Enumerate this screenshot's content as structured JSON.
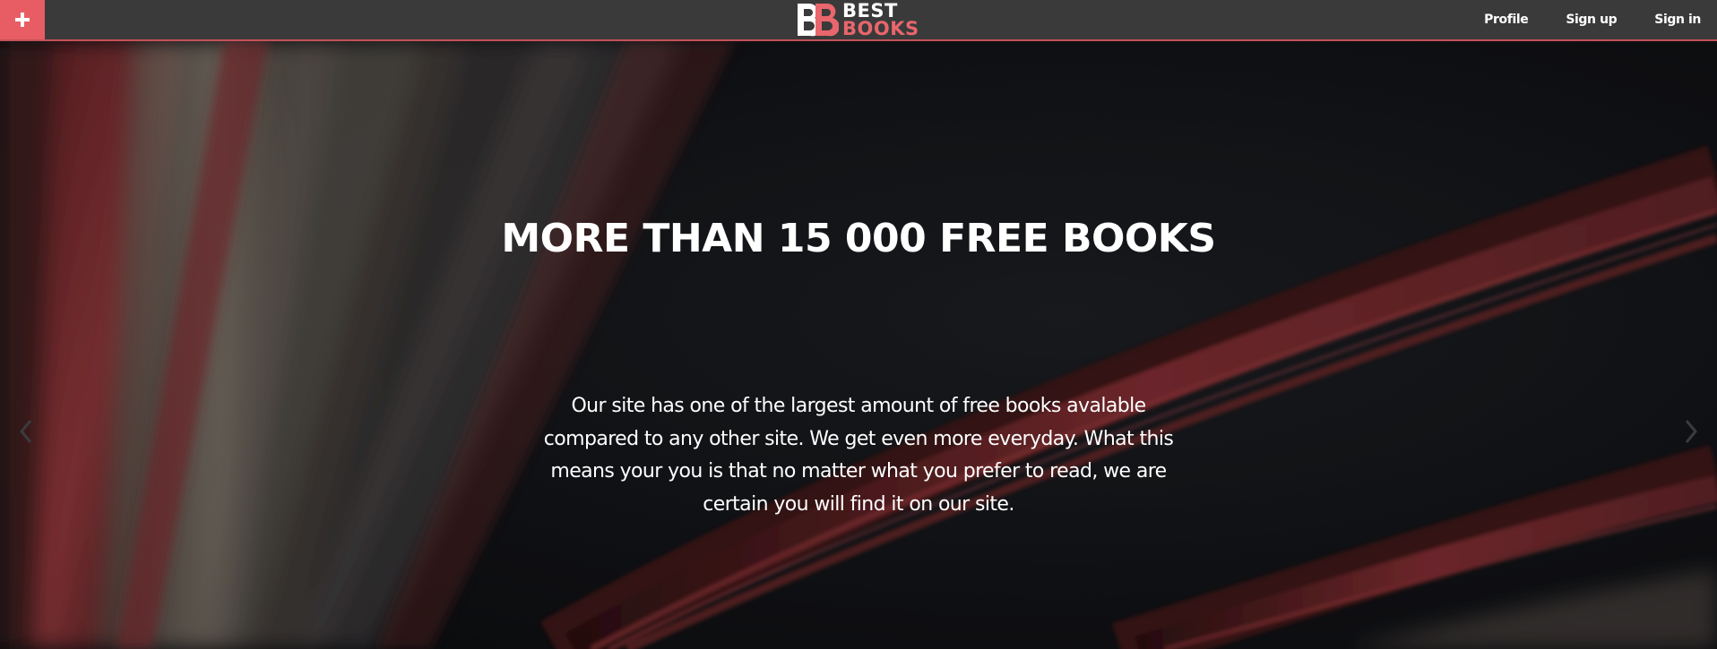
{
  "header": {
    "add_icon": "plus-icon",
    "logo": {
      "top": "BEST",
      "bottom": "BOOKS",
      "mark": "BB"
    },
    "nav": [
      {
        "id": "profile",
        "label": "Profile"
      },
      {
        "id": "sign-up",
        "label": "Sign up"
      },
      {
        "id": "sign-in",
        "label": "Sign in"
      }
    ]
  },
  "hero": {
    "title": "MORE THAN 15 000 FREE BOOKS",
    "description": "Our site has one of the largest amount of free books avalable compared to any other site. We get even more everyday. What this means your you is that no matter what you prefer to read, we are certain you will find it on our site.",
    "prev_icon": "chevron-left-icon",
    "next_icon": "chevron-right-icon"
  },
  "colors": {
    "accent": "#e85d63",
    "topbar": "#3a3a3a",
    "hero_dark": "#121316"
  }
}
